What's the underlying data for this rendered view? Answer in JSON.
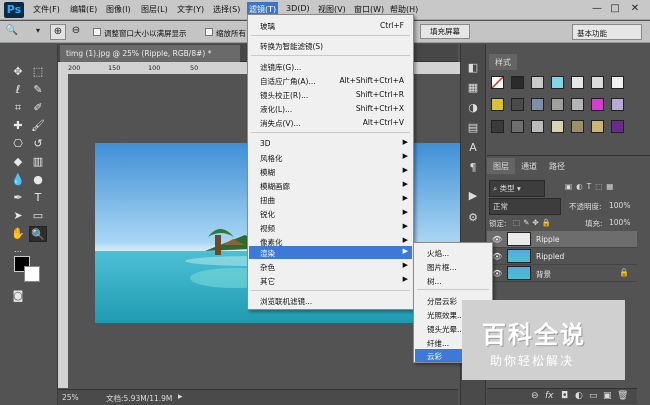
{
  "app": {
    "logo": "Ps",
    "menus": [
      "文件(F)",
      "编辑(E)",
      "图像(I)",
      "图层(L)",
      "文字(Y)",
      "选择(S)",
      "滤镜(T)",
      "3D(D)",
      "视图(V)",
      "窗口(W)",
      "帮助(H)"
    ],
    "window_controls": [
      "—",
      "□",
      "✕"
    ]
  },
  "options": {
    "chk1_label": "调整窗口大小以满屏显示",
    "chk2_label": "缩放所有",
    "fill_screen": "填充屏幕",
    "workspace": "基本功能"
  },
  "document": {
    "tab_title": "timg (1).jpg @ 25% (Ripple, RGB/8#) *",
    "ruler_ticks": [
      "200",
      "150",
      "100",
      "50"
    ],
    "zoom": "25%",
    "doc_info": "文档:5.93M/11.9M"
  },
  "filter_menu": {
    "items": [
      {
        "label": "玻璃",
        "shortcut": "Ctrl+F"
      },
      {
        "label": "转换为智能滤镜(S)",
        "shortcut": ""
      },
      {
        "label": "滤镜库(G)...",
        "shortcut": ""
      },
      {
        "label": "自适应广角(A)...",
        "shortcut": "Alt+Shift+Ctrl+A"
      },
      {
        "label": "镜头校正(R)...",
        "shortcut": "Shift+Ctrl+R"
      },
      {
        "label": "液化(L)...",
        "shortcut": "Shift+Ctrl+X"
      },
      {
        "label": "消失点(V)...",
        "shortcut": "Alt+Ctrl+V"
      },
      {
        "label": "3D",
        "shortcut": ""
      },
      {
        "label": "风格化",
        "shortcut": ""
      },
      {
        "label": "模糊",
        "shortcut": ""
      },
      {
        "label": "模糊画廊",
        "shortcut": ""
      },
      {
        "label": "扭曲",
        "shortcut": ""
      },
      {
        "label": "锐化",
        "shortcut": ""
      },
      {
        "label": "视频",
        "shortcut": ""
      },
      {
        "label": "像素化",
        "shortcut": ""
      },
      {
        "label": "渲染",
        "shortcut": ""
      },
      {
        "label": "杂色",
        "shortcut": ""
      },
      {
        "label": "其它",
        "shortcut": ""
      },
      {
        "label": "浏览联机滤镜...",
        "shortcut": ""
      }
    ],
    "submenu_arrow": "▶"
  },
  "render_menu": {
    "items": [
      "火焰...",
      "图片框...",
      "树...",
      "分层云彩",
      "光照效果...",
      "镜头光晕...",
      "纤维...",
      "云彩"
    ]
  },
  "styles_panel": {
    "tab": "样式"
  },
  "layers_panel": {
    "tabs": [
      "图层",
      "通道",
      "路径"
    ],
    "filter_kind": "类型",
    "blend_mode": "正常",
    "opacity_label": "不透明度:",
    "opacity_value": "100%",
    "lock_label": "锁定:",
    "fill_label": "填充:",
    "fill_value": "100%",
    "layers": [
      "Ripple",
      "Rippled",
      "背景"
    ],
    "bottom_icons": [
      "⊖",
      "fx",
      "◘",
      "◐",
      "▭",
      "▣",
      "🗑"
    ]
  },
  "watermark": {
    "title": "百科全说",
    "subtitle": "助你轻松解决"
  },
  "colors": {
    "menu_highlight": "#3d79d6",
    "panel_bg": "#535353",
    "menubar_bg": "#c8c8c8"
  }
}
